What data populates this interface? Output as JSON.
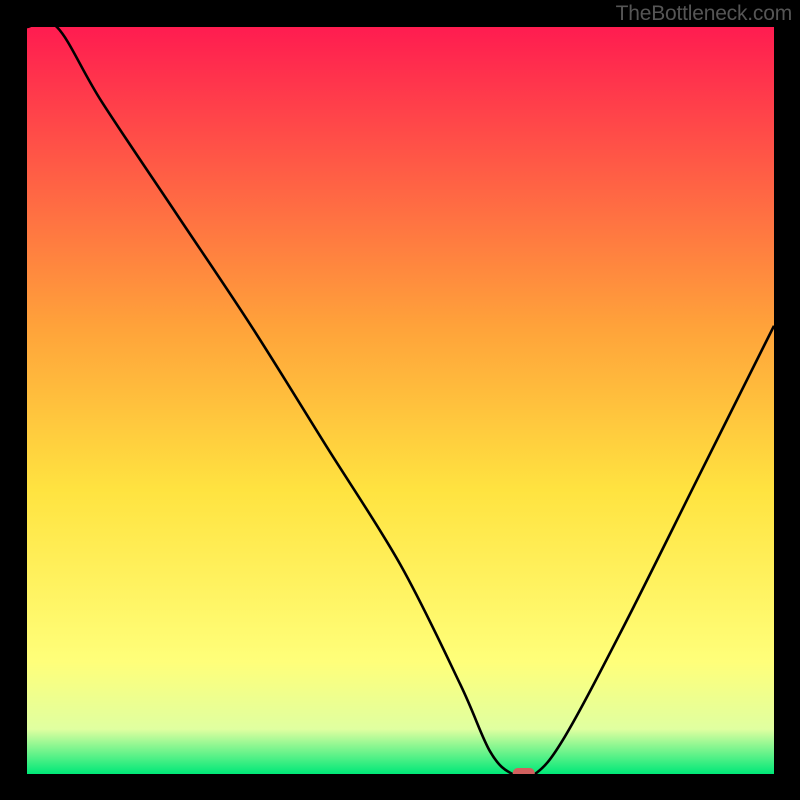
{
  "watermark": "TheBottleneck.com",
  "colors": {
    "gradient_top": "#FF1C50",
    "gradient_mid_upper": "#FFA23A",
    "gradient_mid": "#FFE340",
    "gradient_lower": "#FFFF7A",
    "gradient_near_bottom": "#E0FFA0",
    "gradient_bottom": "#00E878",
    "curve": "#000000",
    "marker": "#D1605E",
    "frame": "#000000"
  },
  "chart_data": {
    "type": "line",
    "title": "",
    "xlabel": "",
    "ylabel": "",
    "xlim": [
      0,
      100
    ],
    "ylim": [
      0,
      100
    ],
    "x": [
      0,
      4,
      10,
      20,
      30,
      40,
      50,
      58,
      62,
      65,
      68,
      72,
      80,
      90,
      100
    ],
    "values": [
      100,
      100,
      90,
      75,
      60,
      44,
      28,
      12,
      3,
      0,
      0,
      5,
      20,
      40,
      60
    ],
    "marker": {
      "x": 66.5,
      "y": 0
    }
  }
}
